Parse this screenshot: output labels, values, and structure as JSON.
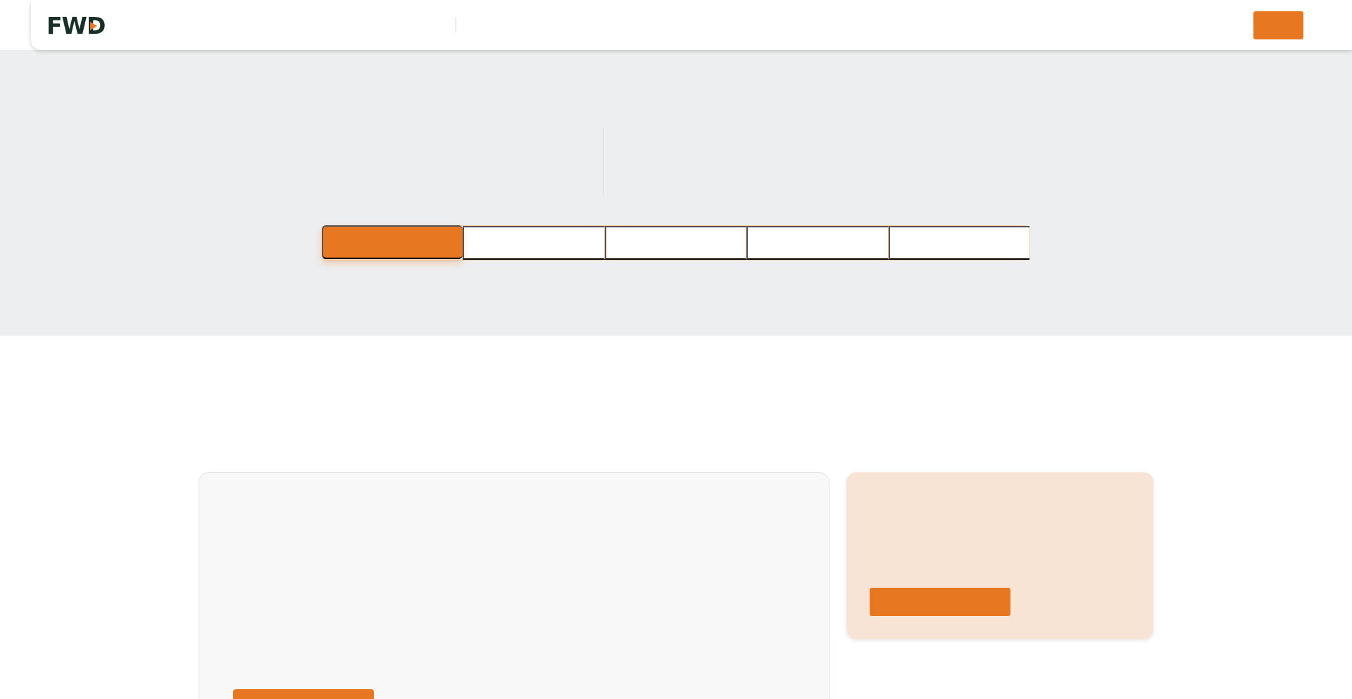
{
  "brand": {
    "logo_text": "FWD",
    "accent_color": "#E87722",
    "dark_color": "#183028"
  },
  "header": {
    "cta_label": ""
  },
  "hero": {
    "tabs": [
      {
        "label": "",
        "active": true
      },
      {
        "label": "",
        "active": false
      },
      {
        "label": "",
        "active": false
      },
      {
        "label": "",
        "active": false
      },
      {
        "label": "",
        "active": false
      }
    ]
  },
  "cards": {
    "left_button_label": "",
    "right_button_label": ""
  }
}
